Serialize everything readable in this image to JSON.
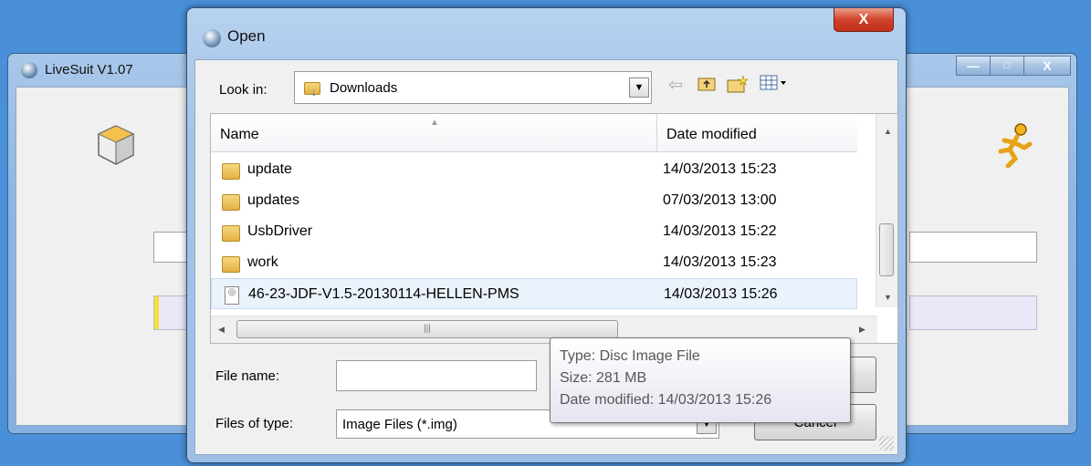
{
  "background_window": {
    "title": "LiveSuit V1.07",
    "controls": {
      "minimize": "—",
      "maximize": "□",
      "close": "X"
    }
  },
  "dialog": {
    "title": "Open",
    "close_label": "X",
    "look_in": {
      "label": "Look in:",
      "value": "Downloads"
    },
    "columns": {
      "name": "Name",
      "date": "Date modified"
    },
    "rows": [
      {
        "name": "update",
        "date": "14/03/2013 15:23",
        "type": "folder"
      },
      {
        "name": "updates",
        "date": "07/03/2013 13:00",
        "type": "folder"
      },
      {
        "name": "UsbDriver",
        "date": "14/03/2013 15:22",
        "type": "folder"
      },
      {
        "name": "work",
        "date": "14/03/2013 15:23",
        "type": "folder"
      },
      {
        "name": "46-23-JDF-V1.5-20130114-HELLEN-PMS",
        "date": "14/03/2013 15:26",
        "type": "disc-image",
        "selected": true
      }
    ],
    "file_name": {
      "label": "File name:",
      "value": ""
    },
    "files_of_type": {
      "label": "Files of type:",
      "value": "Image Files (*.img)"
    },
    "buttons": {
      "cancel": "Cancel"
    },
    "tooltip": {
      "type": "Type: Disc Image File",
      "size": "Size: 281 MB",
      "date": "Date modified: 14/03/2013 15:26"
    },
    "toolbar_icons": [
      "back-icon",
      "up-folder-icon",
      "new-folder-icon",
      "view-menu-icon"
    ]
  }
}
